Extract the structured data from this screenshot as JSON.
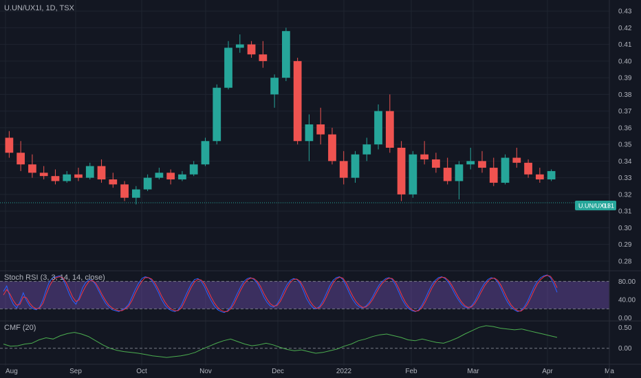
{
  "header": {
    "symbol": "U.UN/UX1I, 1D, TSX"
  },
  "price_tag": {
    "label": "U.UN/UX1I",
    "value": "0.31"
  },
  "colors": {
    "bg": "#131722",
    "up": "#26a69a",
    "down": "#ef5350",
    "grid": "#1f2430",
    "text": "#b2b5be",
    "rsi_k": "#2962ff",
    "rsi_d": "#f23645",
    "cmf": "#4caf50",
    "rsi_band": "#7e57c2",
    "price_tag": "#26a69a"
  },
  "chart_data": [
    {
      "type": "candlestick",
      "title": "U.UN/UX1I, 1D, TSX",
      "x_ticks": [
        "Aug",
        "Sep",
        "Oct",
        "Nov",
        "Dec",
        "2022",
        "Feb",
        "Mar",
        "Apr",
        "Ma"
      ],
      "y_ticks": [
        "0.28",
        "0.29",
        "0.30",
        "0.31",
        "0.32",
        "0.33",
        "0.34",
        "0.35",
        "0.36",
        "0.37",
        "0.38",
        "0.39",
        "0.40",
        "0.41",
        "0.42",
        "0.43"
      ],
      "ylim": [
        0.275,
        0.435
      ],
      "last_price": 0.315,
      "bars": [
        [
          0.354,
          0.358,
          0.342,
          0.345
        ],
        [
          0.345,
          0.352,
          0.334,
          0.338
        ],
        [
          0.338,
          0.344,
          0.33,
          0.333
        ],
        [
          0.333,
          0.337,
          0.329,
          0.331
        ],
        [
          0.331,
          0.335,
          0.326,
          0.328
        ],
        [
          0.328,
          0.334,
          0.327,
          0.332
        ],
        [
          0.332,
          0.336,
          0.328,
          0.33
        ],
        [
          0.33,
          0.339,
          0.329,
          0.337
        ],
        [
          0.337,
          0.341,
          0.327,
          0.329
        ],
        [
          0.329,
          0.333,
          0.324,
          0.326
        ],
        [
          0.326,
          0.328,
          0.316,
          0.318
        ],
        [
          0.318,
          0.325,
          0.314,
          0.323
        ],
        [
          0.323,
          0.332,
          0.322,
          0.33
        ],
        [
          0.33,
          0.336,
          0.329,
          0.333
        ],
        [
          0.333,
          0.335,
          0.326,
          0.329
        ],
        [
          0.329,
          0.334,
          0.328,
          0.332
        ],
        [
          0.332,
          0.34,
          0.331,
          0.338
        ],
        [
          0.338,
          0.354,
          0.337,
          0.352
        ],
        [
          0.352,
          0.386,
          0.35,
          0.384
        ],
        [
          0.384,
          0.412,
          0.383,
          0.408
        ],
        [
          0.408,
          0.416,
          0.405,
          0.41
        ],
        [
          0.41,
          0.412,
          0.402,
          0.404
        ],
        [
          0.404,
          0.412,
          0.396,
          0.4
        ],
        [
          0.38,
          0.392,
          0.372,
          0.39
        ],
        [
          0.39,
          0.42,
          0.388,
          0.418
        ],
        [
          0.4,
          0.402,
          0.35,
          0.352
        ],
        [
          0.352,
          0.368,
          0.34,
          0.362
        ],
        [
          0.362,
          0.372,
          0.35,
          0.356
        ],
        [
          0.356,
          0.36,
          0.338,
          0.34
        ],
        [
          0.34,
          0.346,
          0.326,
          0.33
        ],
        [
          0.33,
          0.346,
          0.327,
          0.344
        ],
        [
          0.344,
          0.354,
          0.34,
          0.35
        ],
        [
          0.35,
          0.374,
          0.347,
          0.37
        ],
        [
          0.37,
          0.38,
          0.345,
          0.348
        ],
        [
          0.348,
          0.352,
          0.316,
          0.32
        ],
        [
          0.32,
          0.346,
          0.318,
          0.344
        ],
        [
          0.344,
          0.352,
          0.338,
          0.341
        ],
        [
          0.341,
          0.345,
          0.333,
          0.336
        ],
        [
          0.336,
          0.342,
          0.326,
          0.328
        ],
        [
          0.328,
          0.34,
          0.317,
          0.338
        ],
        [
          0.338,
          0.348,
          0.335,
          0.34
        ],
        [
          0.34,
          0.346,
          0.333,
          0.336
        ],
        [
          0.336,
          0.342,
          0.325,
          0.327
        ],
        [
          0.327,
          0.344,
          0.326,
          0.342
        ],
        [
          0.342,
          0.348,
          0.336,
          0.339
        ],
        [
          0.339,
          0.341,
          0.33,
          0.332
        ],
        [
          0.332,
          0.336,
          0.327,
          0.329
        ],
        [
          0.329,
          0.335,
          0.328,
          0.334
        ]
      ]
    },
    {
      "type": "line",
      "title": "Stoch RSI (3, 3, 14, 14, close)",
      "y_ticks": [
        "80.00",
        "40.00",
        "0.00"
      ],
      "ylim": [
        -5,
        100
      ],
      "bands": [
        80,
        20
      ],
      "series": [
        {
          "values": [
            58,
            70,
            45,
            30,
            22,
            35,
            55,
            38,
            26,
            20,
            18,
            24,
            40,
            62,
            80,
            88,
            90,
            92,
            86,
            70,
            52,
            38,
            30,
            45,
            66,
            78,
            84,
            82,
            72,
            58,
            44,
            32,
            24,
            18,
            16,
            14,
            18,
            22,
            30,
            46,
            62,
            76,
            86,
            90,
            88,
            82,
            70,
            56,
            40,
            28,
            20,
            16,
            14,
            18,
            28,
            44,
            60,
            74,
            84,
            86,
            80,
            68,
            52,
            38,
            26,
            18,
            14,
            12,
            16,
            24,
            38,
            54,
            68,
            80,
            86,
            88,
            84,
            76,
            62,
            46,
            34,
            26,
            24,
            30,
            42,
            58,
            72,
            82,
            86,
            84,
            76,
            60,
            42,
            30,
            22,
            20,
            26,
            38,
            54,
            70,
            82,
            88,
            90,
            84,
            70,
            54,
            40,
            30,
            24,
            22,
            26,
            34,
            46,
            60,
            72,
            80,
            86,
            88,
            84,
            72,
            56,
            40,
            28,
            20,
            16,
            14,
            18,
            28,
            42,
            58,
            72,
            82,
            88,
            90,
            86,
            78,
            66,
            52,
            40,
            30,
            24,
            22,
            26,
            36,
            50,
            64,
            76,
            84,
            88,
            86,
            78,
            64,
            48,
            34,
            24,
            18,
            14,
            16,
            24,
            36,
            52,
            68,
            80,
            88,
            92,
            94,
            88,
            74,
            56
          ]
        },
        {
          "values": [
            50,
            62,
            52,
            38,
            28,
            30,
            46,
            44,
            32,
            24,
            20,
            22,
            32,
            52,
            70,
            82,
            88,
            90,
            88,
            78,
            62,
            46,
            36,
            40,
            56,
            70,
            80,
            82,
            76,
            64,
            50,
            38,
            28,
            22,
            18,
            16,
            16,
            20,
            26,
            38,
            54,
            68,
            80,
            88,
            88,
            85,
            76,
            63,
            48,
            35,
            25,
            19,
            16,
            16,
            22,
            36,
            52,
            67,
            79,
            84,
            83,
            75,
            61,
            46,
            33,
            23,
            17,
            14,
            14,
            20,
            31,
            46,
            61,
            74,
            83,
            87,
            86,
            80,
            69,
            54,
            41,
            31,
            26,
            27,
            36,
            50,
            65,
            77,
            84,
            85,
            80,
            68,
            52,
            37,
            27,
            21,
            23,
            32,
            46,
            62,
            76,
            85,
            89,
            87,
            77,
            62,
            48,
            36,
            28,
            23,
            24,
            30,
            40,
            53,
            66,
            76,
            83,
            87,
            86,
            78,
            64,
            48,
            34,
            24,
            18,
            15,
            16,
            23,
            35,
            50,
            65,
            77,
            85,
            89,
            88,
            82,
            72,
            59,
            46,
            35,
            27,
            23,
            24,
            31,
            43,
            57,
            70,
            80,
            86,
            87,
            82,
            71,
            56,
            41,
            29,
            21,
            16,
            15,
            20,
            30,
            44,
            60,
            74,
            84,
            90,
            93,
            91,
            81,
            66
          ]
        }
      ]
    },
    {
      "type": "line",
      "title": "CMF (20)",
      "y_ticks": [
        "0.50",
        "0.00"
      ],
      "ylim": [
        -0.35,
        0.62
      ],
      "series": [
        {
          "values": [
            0.1,
            0.05,
            0.06,
            0.1,
            0.12,
            0.2,
            0.25,
            0.22,
            0.3,
            0.35,
            0.38,
            0.34,
            0.28,
            0.18,
            0.08,
            0.0,
            -0.05,
            -0.08,
            -0.1,
            -0.12,
            -0.15,
            -0.18,
            -0.2,
            -0.22,
            -0.2,
            -0.18,
            -0.15,
            -0.1,
            -0.02,
            0.05,
            0.12,
            0.18,
            0.22,
            0.16,
            0.1,
            0.06,
            0.08,
            0.12,
            0.08,
            0.02,
            -0.03,
            -0.06,
            -0.04,
            -0.08,
            -0.12,
            -0.1,
            -0.06,
            -0.02,
            0.05,
            0.1,
            0.18,
            0.22,
            0.28,
            0.32,
            0.34,
            0.3,
            0.26,
            0.2,
            0.18,
            0.22,
            0.18,
            0.14,
            0.12,
            0.18,
            0.25,
            0.34,
            0.42,
            0.5,
            0.54,
            0.52,
            0.48,
            0.46,
            0.44,
            0.46,
            0.42,
            0.38,
            0.34,
            0.3,
            0.26
          ]
        }
      ]
    }
  ]
}
